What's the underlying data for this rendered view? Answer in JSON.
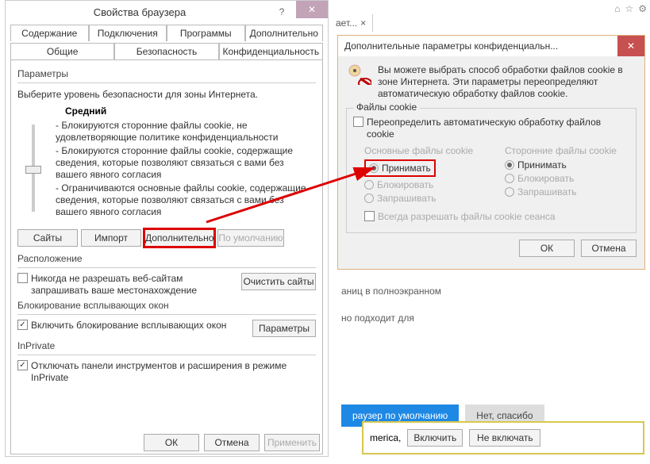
{
  "mainDialog": {
    "title": "Свойства браузера",
    "tabs1": [
      "Содержание",
      "Подключения",
      "Программы",
      "Дополнительно"
    ],
    "tabs2": [
      "Общие",
      "Безопасность",
      "Конфиденциальность"
    ],
    "params": "Параметры",
    "chooseLevel": "Выберите уровень безопасности для зоны Интернета.",
    "medium": "Средний",
    "desc1": "- Блокируются сторонние файлы cookie, не удовлетворяющие политике конфиденциальности",
    "desc2": "- Блокируются сторонние файлы cookie, содержащие сведения, которые позволяют связаться с вами без вашего явного согласия",
    "desc3": "- Ограничиваются основные файлы cookie, содержащие сведения, которые позволяют связаться с вами без вашего явного согласия",
    "btnSites": "Сайты",
    "btnImport": "Импорт",
    "btnAdvanced": "Дополнительно",
    "btnDefault": "По умолчанию",
    "location": "Расположение",
    "neverAllow": "Никогда не разрешать веб-сайтам запрашивать ваше местонахождение",
    "clearSites": "Очистить сайты",
    "popupBlocking": "Блокирование всплывающих окон",
    "enablePopup": "Включить блокирование всплывающих окон",
    "btnParams": "Параметры",
    "inprivate": "InPrivate",
    "disableToolbars": "Отключать панели инструментов и расширения в режиме InPrivate",
    "btnOK": "ОК",
    "btnCancel": "Отмена",
    "btnApply": "Применить"
  },
  "dialog2": {
    "title": "Дополнительные параметры конфиденциальн...",
    "explain": "Вы можете выбрать способ обработки файлов cookie в зоне Интернета. Эти параметры переопределяют автоматическую обработку файлов cookie.",
    "filesCookie": "Файлы cookie",
    "override": "Переопределить автоматическую обработку файлов cookie",
    "col1": "Основные файлы cookie",
    "col2": "Сторонние файлы cookie",
    "r_accept": "Принимать",
    "r_block": "Блокировать",
    "r_ask": "Запрашивать",
    "sessionCookie": "Всегда разрешать файлы cookie сеанса",
    "ok": "ОК",
    "cancel": "Отмена"
  },
  "bg": {
    "tabCut": "ает...",
    "big1": "аниц в полноэкранном",
    "big2": "но подходит для",
    "defaultBtn": "раузер по умолчанию",
    "noThanks": "Нет, спасибо"
  },
  "toast": {
    "text": "merica,",
    "enable": "Включить",
    "disable": "Не включать"
  }
}
